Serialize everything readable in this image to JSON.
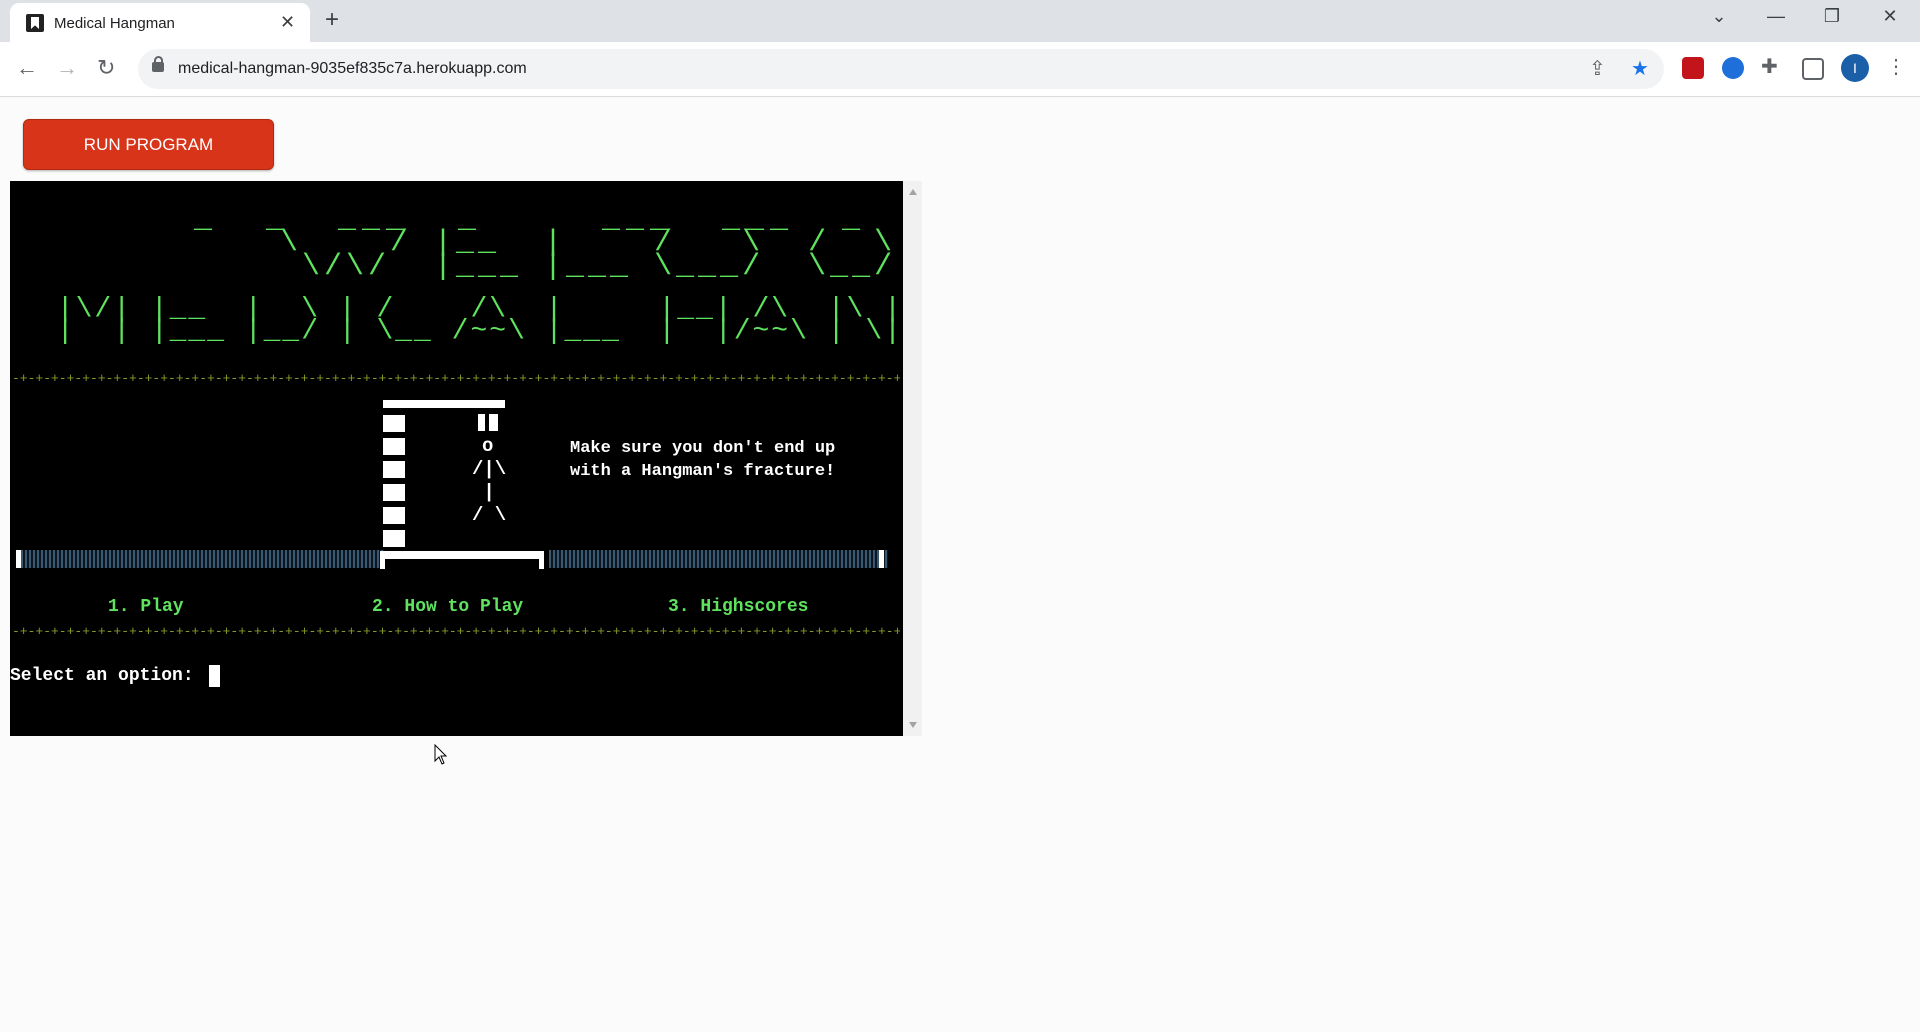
{
  "browser": {
    "tab_title": "Medical Hangman",
    "tab_close": "✕",
    "new_tab": "+",
    "url": "medical-hangman-9035ef835c7a.herokuapp.com",
    "window_controls": {
      "chevron": "⌄",
      "minimize": "—",
      "restore": "❐",
      "close": "✕"
    },
    "nav": {
      "back": "←",
      "forward": "→",
      "reload": "↻"
    },
    "profile_initial": "I"
  },
  "page": {
    "run_button": "RUN PROGRAM"
  },
  "terminal": {
    "banner_line1": " _  _  ___  _     ___  ___  _  _  ___    ___  ___",
    "welcome_art": [
      "     \\    / |__  |    /   \\  /  \\  |\\/| |__    |  /  \\",
      "      \\/\\/  |___ |___ \\___/  \\__/  |  | |___   |  \\__/"
    ],
    "title_art": [
      "                                                         /",
      " |\\/| |__  |  \\ | /    /\\  |     |__| /\\  |\\ | /  _ |\\/|  /\\  |\\ | /",
      " |  | |___ |__/ | \\__ /~~\\ |___  |  |/~~\\ | \\| \\__> |  | /~~\\ | \\|."
    ],
    "divider": "-+-+-+-+-+-+-+-+-+-+-+-+-+-+-+-+-+-+-+-+-+-+-+-+-+-+-+-+-+-+-+-+-+-+-+-+-+-+-+-+-+-+-+-+-+-+-+-+-+-+-+-+-+-+-+-+-+-+-+-+-+-+-+-+-+-+-+-",
    "figure": [
      "o",
      "/|\\",
      " |",
      "/ \\"
    ],
    "caption": [
      "Make sure you don't end up",
      "with a Hangman's fracture!"
    ],
    "menu": {
      "play": "1. Play",
      "how_to_play": "2. How to Play",
      "highscores": "3. Highscores"
    },
    "prompt": "Select an option: "
  },
  "colors": {
    "terminal_bg": "#000000",
    "ascii_green": "#5fe35f",
    "run_button": "#d8341a",
    "divider": "#8a9a2a"
  }
}
